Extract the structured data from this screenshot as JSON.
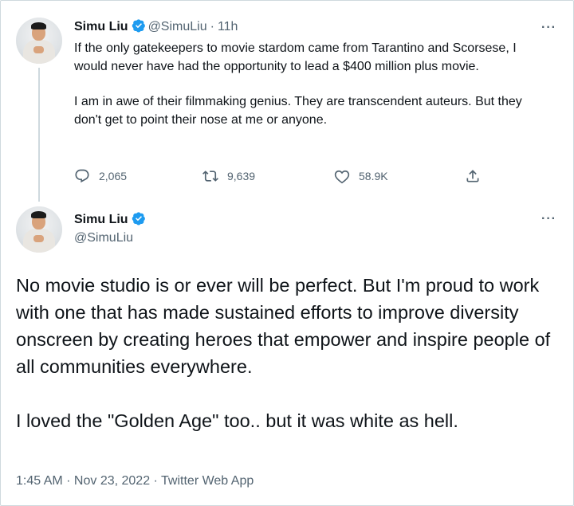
{
  "reply_tweet": {
    "author_name": "Simu Liu",
    "handle": "@SimuLiu",
    "separator": "·",
    "time_ago": "11h",
    "more_label": "···",
    "paragraphs": [
      "If the only gatekeepers to movie stardom came from Tarantino and Scorsese, I would never have had the opportunity to lead a $400 million plus movie.",
      "I am in awe of their filmmaking genius. They are transcendent auteurs. But they don't get to point their nose at me or anyone."
    ],
    "actions": {
      "replies": "2,065",
      "retweets": "9,639",
      "likes": "58.9K"
    }
  },
  "main_tweet": {
    "author_name": "Simu Liu",
    "handle": "@SimuLiu",
    "more_label": "···",
    "paragraphs": [
      "No movie studio is or ever will be perfect. But I'm proud to work with one that has made sustained efforts to improve diversity onscreen by creating heroes that empower and inspire people of all communities everywhere.",
      "I loved the \"Golden Age\" too.. but it was white as hell."
    ],
    "meta": "1:45 AM · Nov 23, 2022 · Twitter Web App"
  },
  "colors": {
    "verified_badge": "#1d9bf0",
    "secondary_text": "#536471",
    "primary_text": "#0f1419",
    "border": "#cfd9de"
  },
  "icons": [
    "verified-badge-icon",
    "reply-icon",
    "retweet-icon",
    "like-icon",
    "share-icon",
    "more-icon"
  ]
}
